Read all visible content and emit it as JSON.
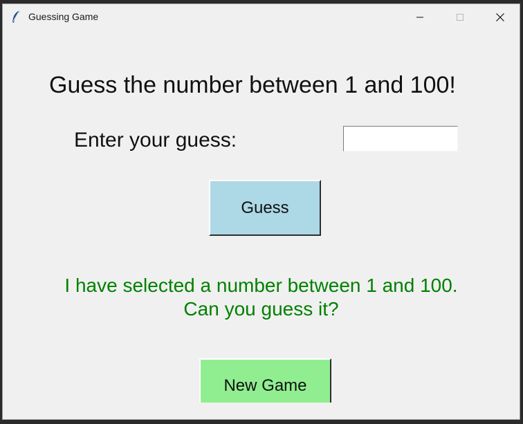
{
  "window": {
    "title": "Guessing Game",
    "icon": "feather-icon",
    "controls": {
      "minimize": "minimize-icon",
      "maximize": "maximize-icon",
      "close": "close-icon"
    }
  },
  "game": {
    "headline": "Guess the number between 1 and 100!",
    "prompt_label": "Enter your guess:",
    "guess_value": "",
    "guess_button_label": "Guess",
    "status_line_1": "I have selected a number between 1 and 100.",
    "status_line_2": "Can you guess it?",
    "new_game_button_label": "New Game"
  },
  "colors": {
    "window_background": "#f0f0f0",
    "guess_button": "#add8e6",
    "new_game_button": "#90ee90",
    "status_text": "#008000"
  }
}
